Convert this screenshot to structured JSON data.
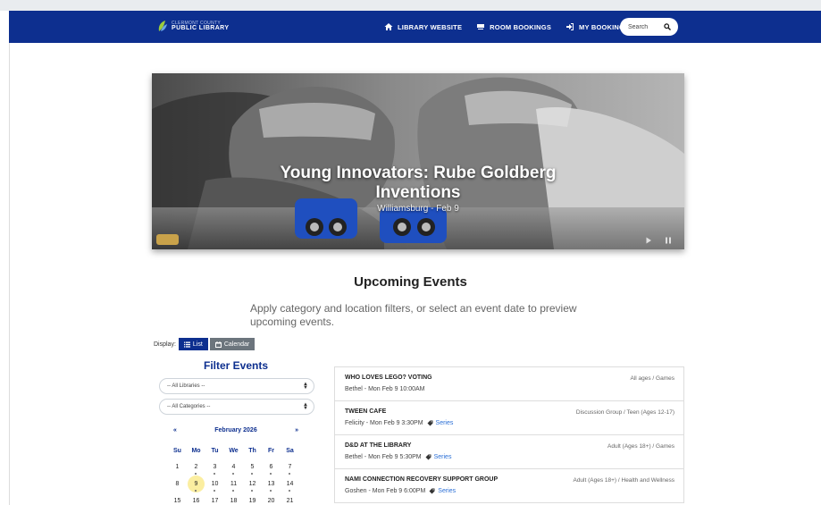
{
  "navbar": {
    "logo_small": "CLERMONT COUNTY",
    "logo_big": "PUBLIC LIBRARY",
    "links": [
      {
        "label": "LIBRARY WEBSITE",
        "icon": "home-icon"
      },
      {
        "label": "ROOM BOOKINGS",
        "icon": "room-icon"
      },
      {
        "label": "MY BOOKINGS",
        "icon": "sign-in-icon"
      }
    ],
    "search_placeholder": "Search",
    "color": "#0d2f8f"
  },
  "hero": {
    "title_line1": "Young Innovators: Rube Goldberg",
    "title_line2": "Inventions",
    "subtitle": "Williamsburg - Feb 9"
  },
  "upcoming": {
    "title": "Upcoming Events",
    "description": "Apply category and location filters, or select an event date to preview upcoming events."
  },
  "display": {
    "label": "Display:",
    "list_label": "List",
    "calendar_label": "Calendar"
  },
  "filters": {
    "title": "Filter Events",
    "libraries": "-- All Libraries --",
    "categories": "-- All Categories --"
  },
  "calendar": {
    "prev": "«",
    "next": "»",
    "month": "February 2026",
    "weekdays": [
      "Su",
      "Mo",
      "Tu",
      "We",
      "Th",
      "Fr",
      "Sa"
    ],
    "days": [
      {
        "d": "1",
        "dot": false
      },
      {
        "d": "2",
        "dot": true
      },
      {
        "d": "3",
        "dot": true
      },
      {
        "d": "4",
        "dot": true
      },
      {
        "d": "5",
        "dot": true
      },
      {
        "d": "6",
        "dot": true
      },
      {
        "d": "7",
        "dot": true
      },
      {
        "d": "8",
        "dot": false
      },
      {
        "d": "9",
        "dot": true,
        "today": true
      },
      {
        "d": "10",
        "dot": true
      },
      {
        "d": "11",
        "dot": true
      },
      {
        "d": "12",
        "dot": true
      },
      {
        "d": "13",
        "dot": true
      },
      {
        "d": "14",
        "dot": true
      },
      {
        "d": "15",
        "dot": false
      },
      {
        "d": "16",
        "dot": false
      },
      {
        "d": "17",
        "dot": false
      },
      {
        "d": "18",
        "dot": false
      },
      {
        "d": "19",
        "dot": false
      },
      {
        "d": "20",
        "dot": false
      },
      {
        "d": "21",
        "dot": false
      }
    ]
  },
  "events": [
    {
      "title": "WHO LOVES LEGO? VOTING",
      "sub": "Bethel - Mon Feb 9 10:00AM",
      "series": "",
      "category": "All ages / Games"
    },
    {
      "title": "TWEEN CAFE",
      "sub": "Felicity - Mon Feb 9 3:30PM",
      "series": "Series",
      "category": "Discussion Group / Teen (Ages 12-17)"
    },
    {
      "title": "D&D AT THE LIBRARY",
      "sub": "Bethel - Mon Feb 9 5:30PM",
      "series": "Series",
      "category": "Adult (Ages 18+) / Games"
    },
    {
      "title": "NAMI CONNECTION RECOVERY SUPPORT GROUP",
      "sub": "Goshen - Mon Feb 9 6:00PM",
      "series": "Series",
      "category": "Adult (Ages 18+) / Health and Wellness"
    }
  ]
}
